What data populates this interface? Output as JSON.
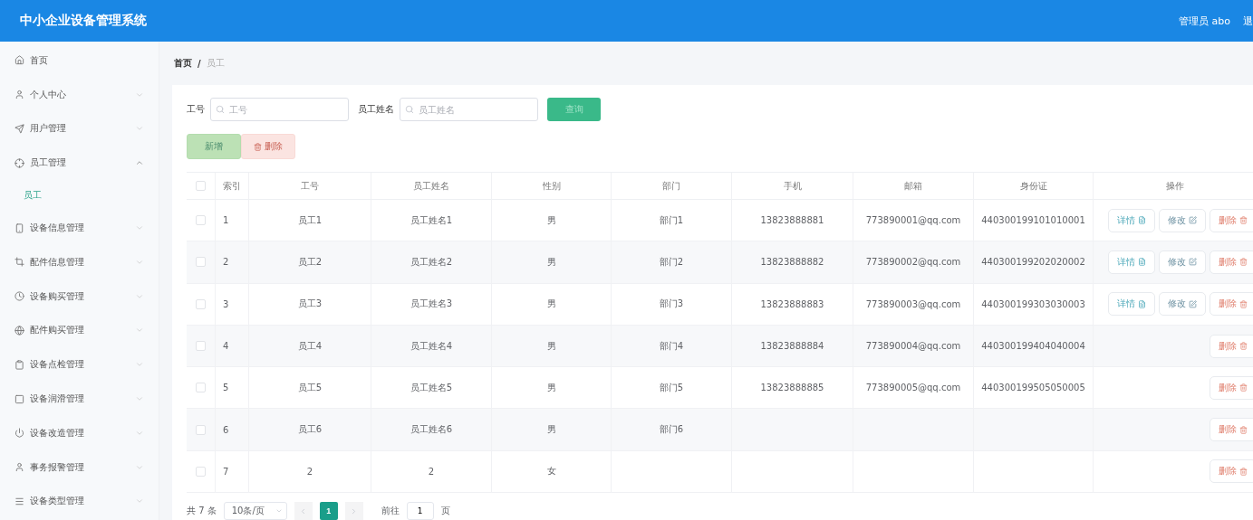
{
  "header": {
    "title": "中小企业设备管理系统",
    "user": "管理员 abo",
    "logout": "退"
  },
  "sidebar": {
    "items": [
      {
        "label": "首页"
      },
      {
        "label": "个人中心",
        "expanded": false
      },
      {
        "label": "用户管理",
        "expanded": false
      },
      {
        "label": "员工管理",
        "expanded": true,
        "children": [
          {
            "label": "员工",
            "selected": true
          }
        ]
      },
      {
        "label": "设备信息管理",
        "expanded": false
      },
      {
        "label": "配件信息管理",
        "expanded": false
      },
      {
        "label": "设备购买管理",
        "expanded": false
      },
      {
        "label": "配件购买管理",
        "expanded": false
      },
      {
        "label": "设备点检管理",
        "expanded": false
      },
      {
        "label": "设备润滑管理",
        "expanded": false
      },
      {
        "label": "设备改造管理",
        "expanded": false
      },
      {
        "label": "事务报警管理",
        "expanded": false
      },
      {
        "label": "设备类型管理",
        "expanded": false
      }
    ]
  },
  "breadcrumb": {
    "items": [
      "首页",
      "员工"
    ],
    "separator": "/"
  },
  "search": {
    "fields": [
      {
        "label": "工号",
        "placeholder": "工号"
      },
      {
        "label": "员工姓名",
        "placeholder": "员工姓名"
      }
    ],
    "button": "查询"
  },
  "toolbar": [
    {
      "kind": "add",
      "label": "新增",
      "disabled": true
    },
    {
      "kind": "delete",
      "label": "删除",
      "disabled": true
    }
  ],
  "table": {
    "header_checked": false,
    "columns": [
      "索引",
      "工号",
      "员工姓名",
      "性别",
      "部门",
      "手机",
      "邮箱",
      "身份证",
      "操作"
    ],
    "rows": [
      {
        "checked": false,
        "cells": [
          "1",
          "员工1",
          "员工姓名1",
          "男",
          "部门1",
          "13823888881",
          "773890001@qq.com",
          "440300199101010001"
        ],
        "actions": [
          {
            "kind": "detail",
            "label": "详情"
          },
          {
            "kind": "edit",
            "label": "修改"
          },
          {
            "kind": "delete",
            "label": "删除"
          }
        ]
      },
      {
        "checked": false,
        "cells": [
          "2",
          "员工2",
          "员工姓名2",
          "男",
          "部门2",
          "13823888882",
          "773890002@qq.com",
          "440300199202020002"
        ],
        "actions": [
          {
            "kind": "detail",
            "label": "详情"
          },
          {
            "kind": "edit",
            "label": "修改"
          },
          {
            "kind": "delete",
            "label": "删除"
          }
        ]
      },
      {
        "checked": false,
        "cells": [
          "3",
          "员工3",
          "员工姓名3",
          "男",
          "部门3",
          "13823888883",
          "773890003@qq.com",
          "440300199303030003"
        ],
        "actions": [
          {
            "kind": "detail",
            "label": "详情"
          },
          {
            "kind": "edit",
            "label": "修改"
          },
          {
            "kind": "delete",
            "label": "删除"
          }
        ]
      },
      {
        "checked": false,
        "cells": [
          "4",
          "员工4",
          "员工姓名4",
          "男",
          "部门4",
          "13823888884",
          "773890004@qq.com",
          "440300199404040004"
        ],
        "actions": [
          {
            "kind": "delete",
            "label": "删除"
          }
        ]
      },
      {
        "checked": false,
        "cells": [
          "5",
          "员工5",
          "员工姓名5",
          "男",
          "部门5",
          "13823888885",
          "773890005@qq.com",
          "440300199505050005"
        ],
        "actions": [
          {
            "kind": "delete",
            "label": "删除"
          }
        ]
      },
      {
        "checked": false,
        "cells": [
          "6",
          "员工6",
          "员工姓名6",
          "男",
          "部门6"
        ],
        "actions": [
          {
            "kind": "delete",
            "label": "删除"
          }
        ]
      },
      {
        "checked": false,
        "cells": [
          "7",
          "2",
          "2",
          "女"
        ],
        "actions": [
          {
            "kind": "delete",
            "label": "删除"
          }
        ]
      }
    ]
  },
  "pagination": {
    "total": "共 7 条",
    "page_size": "10条/页",
    "pages": [
      {
        "label": "1",
        "selected": true
      }
    ],
    "goto_label": "前往",
    "goto_value": "1",
    "goto_suffix": "页"
  }
}
